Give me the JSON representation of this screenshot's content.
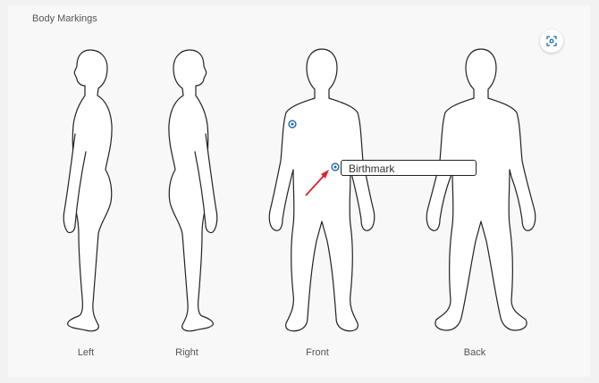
{
  "panel": {
    "title": "Body Markings",
    "focus_icon": "focus-scan-icon"
  },
  "views": [
    {
      "label": "Left"
    },
    {
      "label": "Right"
    },
    {
      "label": "Front"
    },
    {
      "label": "Back"
    }
  ],
  "markings": [
    {
      "view": "Front",
      "note": ""
    },
    {
      "view": "Front",
      "note": "Birthmark"
    }
  ],
  "colors": {
    "marker": "#1f6fa8",
    "arrow": "#d9262c",
    "outline": "#222222"
  }
}
